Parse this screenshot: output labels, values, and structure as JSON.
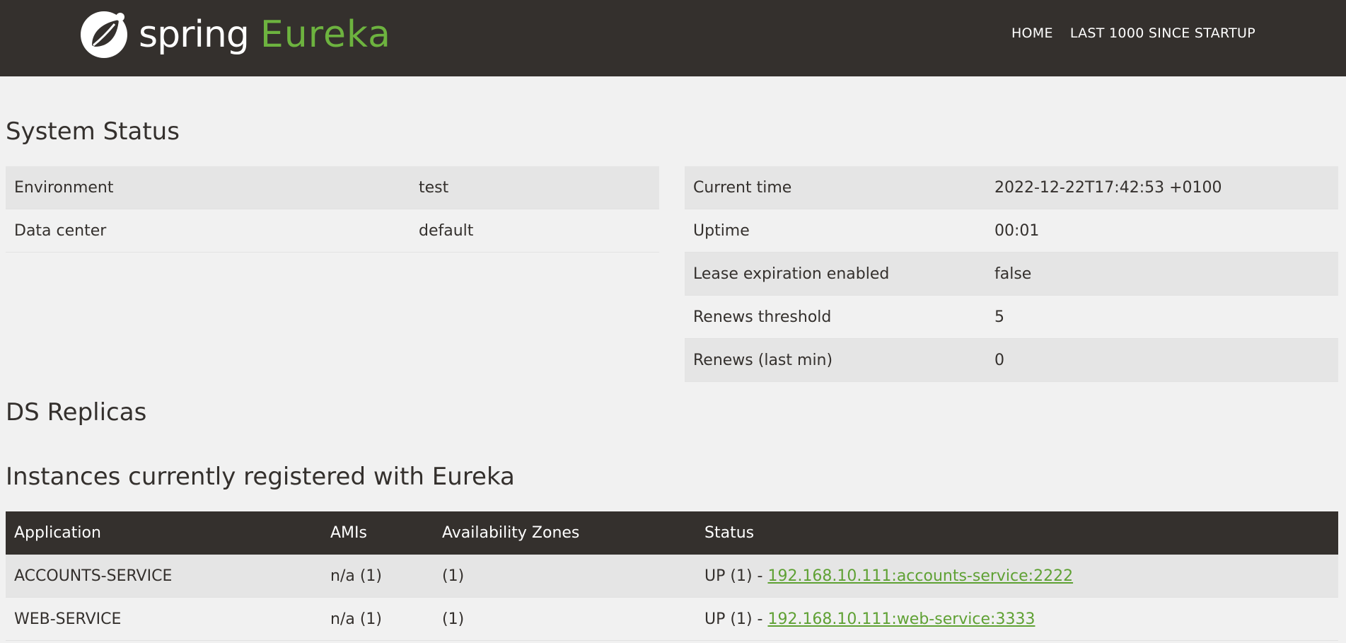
{
  "brand": {
    "spring": "spring",
    "eureka": "Eureka",
    "accent": "#6db33f",
    "dark": "#34302d"
  },
  "nav": {
    "home": "HOME",
    "last1000": "LAST 1000 SINCE STARTUP"
  },
  "system_status": {
    "heading": "System Status",
    "left": [
      {
        "key": "Environment",
        "value": "test"
      },
      {
        "key": "Data center",
        "value": "default"
      }
    ],
    "right": [
      {
        "key": "Current time",
        "value": "2022-12-22T17:42:53 +0100"
      },
      {
        "key": "Uptime",
        "value": "00:01"
      },
      {
        "key": "Lease expiration enabled",
        "value": "false"
      },
      {
        "key": "Renews threshold",
        "value": "5"
      },
      {
        "key": "Renews (last min)",
        "value": "0"
      }
    ]
  },
  "ds_replicas": {
    "heading": "DS Replicas"
  },
  "instances": {
    "heading": "Instances currently registered with Eureka",
    "columns": [
      "Application",
      "AMIs",
      "Availability Zones",
      "Status"
    ],
    "rows": [
      {
        "application": "ACCOUNTS-SERVICE",
        "amis_name": "n/a",
        "amis_count": "(1)",
        "zones": "(1)",
        "status_prefix": "UP (1) - ",
        "status_link": "192.168.10.111:accounts-service:2222"
      },
      {
        "application": "WEB-SERVICE",
        "amis_name": "n/a",
        "amis_count": "(1)",
        "zones": "(1)",
        "status_prefix": "UP (1) - ",
        "status_link": "192.168.10.111:web-service:3333"
      }
    ]
  }
}
